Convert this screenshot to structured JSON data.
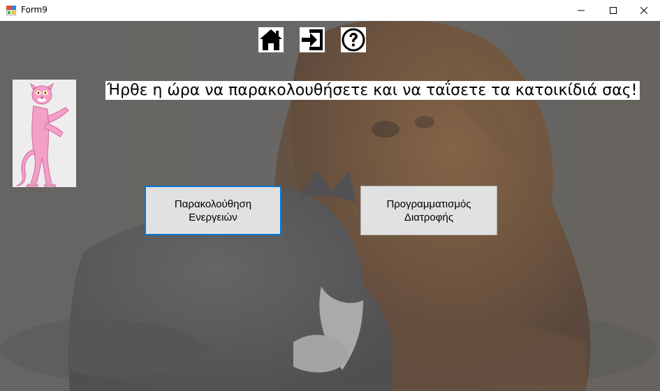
{
  "window": {
    "title": "Form9",
    "icons": {
      "app": "form-app-icon",
      "minimize": "minimize-icon",
      "maximize": "maximize-icon",
      "close": "close-icon"
    }
  },
  "toolbar": {
    "icons": [
      "home-icon",
      "logout-icon",
      "help-icon"
    ]
  },
  "main": {
    "headline": "Ήρθε η ώρα να παρακολουθήσετε και να ταΐσετε τα κατοικίδιά σας!",
    "avatar": "pink-panther-avatar",
    "buttons": {
      "activity": {
        "line1": "Παρακολούθηση",
        "line2": "Ενεργειών"
      },
      "diet": {
        "line1": "Προγραμματισμός",
        "line2": "Διατροφής"
      }
    }
  },
  "colors": {
    "focus_border": "#0078d7",
    "button_face": "#e1e1e1",
    "background_overlay": "#6a6866"
  }
}
